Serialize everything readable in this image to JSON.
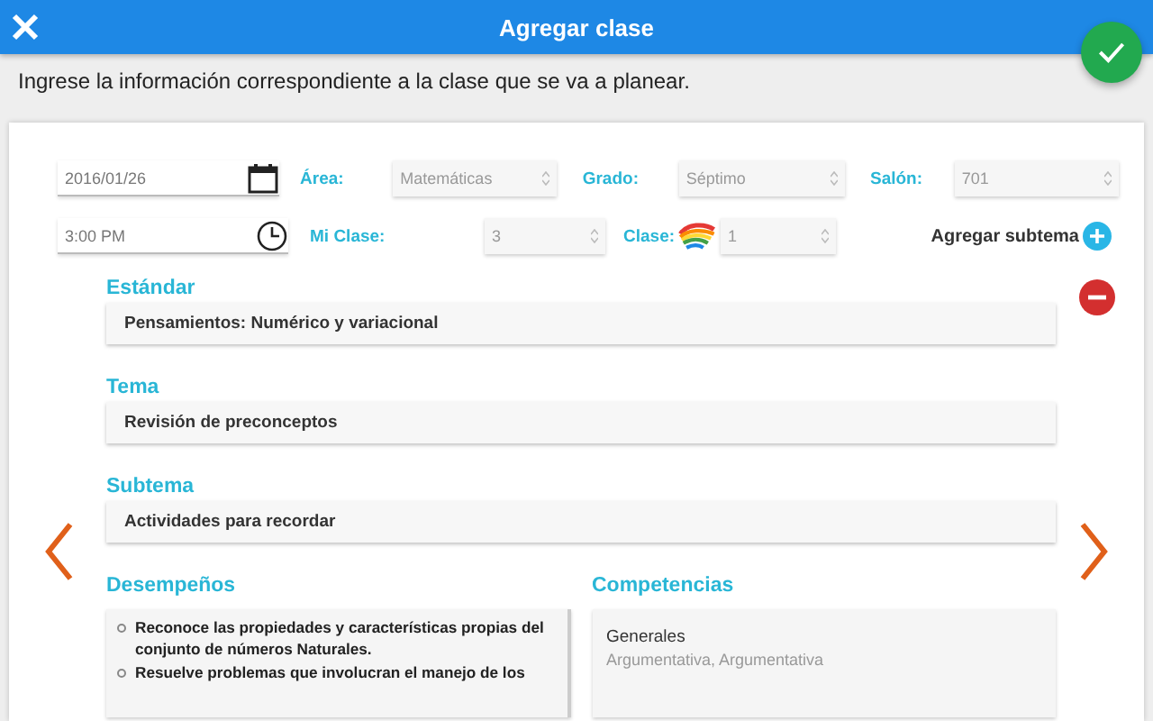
{
  "header": {
    "title": "Agregar clase"
  },
  "instructions": "Ingrese la información correspondiente a la clase que se va a planear.",
  "form_rows": [
    [
      {
        "kind": "date",
        "value": "2016/01/26"
      },
      {
        "kind": "select",
        "label": "Área:",
        "value": "Matemáticas"
      },
      {
        "kind": "select",
        "label": "Grado:",
        "value": "Séptimo"
      },
      {
        "kind": "select",
        "label": "Salón:",
        "value": "701"
      }
    ],
    [
      {
        "kind": "time",
        "value": "3:00 PM"
      },
      {
        "kind": "select",
        "label": "Mi Clase:",
        "value": "3"
      },
      {
        "kind": "select_icon",
        "label": "Clase:",
        "value": "1"
      },
      {
        "kind": "action",
        "label": "Agregar subtema"
      }
    ]
  ],
  "sections": [
    {
      "title": "Estándar",
      "value": "Pensamientos: Numérico y variacional",
      "removable": true
    },
    {
      "title": "Tema",
      "value": "Revisión de preconceptos",
      "removable": false
    },
    {
      "title": "Subtema",
      "value": "Actividades para recordar",
      "removable": false
    }
  ],
  "desempenos": {
    "title": "Desempeños",
    "items": [
      "Reconoce las propiedades y características propias del conjunto de números Naturales.",
      "Resuelve problemas que involucran el manejo de los"
    ]
  },
  "competencias": {
    "title": "Competencias",
    "groups": [
      {
        "name": "Generales",
        "value": "Argumentativa, Argumentativa"
      }
    ]
  }
}
